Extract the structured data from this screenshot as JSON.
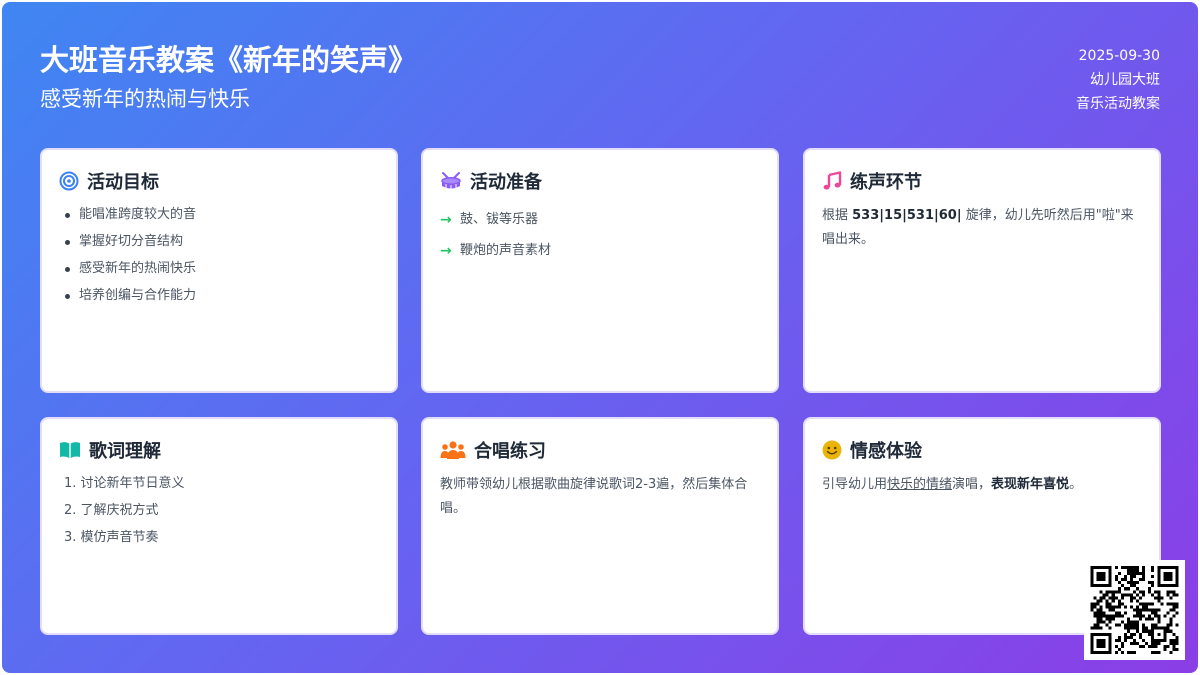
{
  "header": {
    "title": "大班音乐教案《新年的笑声》",
    "subtitle": "感受新年的热闹与快乐",
    "date": "2025-09-30",
    "grade": "幼儿园大班",
    "type": "音乐活动教案"
  },
  "cards": {
    "goals": {
      "title": "活动目标",
      "icon": "target-icon",
      "icon_color": "#3b82f6",
      "items": [
        "能唱准跨度较大的音",
        "掌握好切分音结构",
        "感受新年的热闹快乐",
        "培养创编与合作能力"
      ]
    },
    "prep": {
      "title": "活动准备",
      "icon": "drum-icon",
      "icon_color": "#8b5cf6",
      "bullet_color": "#22c55e",
      "items": [
        "鼓、钹等乐器",
        "鞭炮的声音素材"
      ]
    },
    "vocal": {
      "title": "练声环节",
      "icon": "music-note-icon",
      "icon_color": "#ec4899",
      "text_pre": "根据 ",
      "text_bold": "533|15|531|60|",
      "text_post": " 旋律，幼儿先听然后用\"啦\"来唱出来。"
    },
    "lyrics": {
      "title": "歌词理解",
      "icon": "book-icon",
      "icon_color": "#14b8a6",
      "items": [
        "1. 讨论新年节日意义",
        "2. 了解庆祝方式",
        "3. 模仿声音节奏"
      ]
    },
    "chorus": {
      "title": "合唱练习",
      "icon": "group-icon",
      "icon_color": "#f97316",
      "text": "教师带领幼儿根据歌曲旋律说歌词2-3遍，然后集体合唱。"
    },
    "emotion": {
      "title": "情感体验",
      "icon": "smile-icon",
      "icon_color": "#eab308",
      "text_pre": "引导幼儿用",
      "text_underline": "快乐的情绪",
      "text_mid": "演唱，",
      "text_bold": "表现新年喜悦",
      "text_post": "。"
    }
  },
  "colors": {
    "gradient_start": "#3f86f2",
    "gradient_end": "#8b3ee6"
  }
}
